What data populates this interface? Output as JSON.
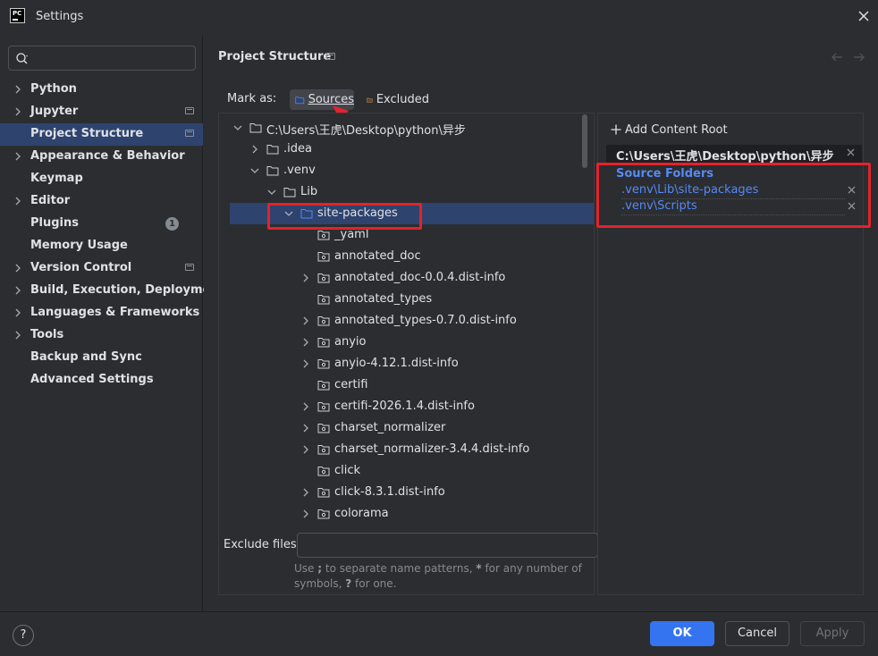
{
  "window": {
    "title": "Settings",
    "logo_text": "PC"
  },
  "search": {
    "value": "",
    "placeholder": ""
  },
  "sidebar": {
    "items": [
      {
        "label": "Python",
        "expandable": true
      },
      {
        "label": "Jupyter",
        "expandable": true,
        "project_icon": true
      },
      {
        "label": "Project Structure",
        "selected": true,
        "project_icon": true
      },
      {
        "label": "Appearance & Behavior",
        "expandable": true
      },
      {
        "label": "Keymap"
      },
      {
        "label": "Editor",
        "expandable": true
      },
      {
        "label": "Plugins",
        "badge": "1"
      },
      {
        "label": "Memory Usage"
      },
      {
        "label": "Version Control",
        "expandable": true,
        "project_icon": true
      },
      {
        "label": "Build, Execution, Deployment",
        "expandable": true
      },
      {
        "label": "Languages & Frameworks",
        "expandable": true
      },
      {
        "label": "Tools",
        "expandable": true
      },
      {
        "label": "Backup and Sync"
      },
      {
        "label": "Advanced Settings"
      }
    ]
  },
  "main": {
    "title": "Project Structure",
    "mark_as": {
      "label": "Mark as:",
      "sources_label": "Sources",
      "excluded_label": "Excluded"
    },
    "tree": {
      "rows": [
        {
          "label": "C:\\Users\\王虎\\Desktop\\python\\异步",
          "depth": 0,
          "chevron": "down",
          "type": "folder"
        },
        {
          "label": ".idea",
          "depth": 1,
          "chevron": "right",
          "type": "folder"
        },
        {
          "label": ".venv",
          "depth": 1,
          "chevron": "down",
          "type": "folder"
        },
        {
          "label": "Lib",
          "depth": 2,
          "chevron": "down",
          "type": "folder"
        },
        {
          "label": "site-packages",
          "depth": 3,
          "chevron": "down",
          "type": "source",
          "selected": true
        },
        {
          "label": "_yaml",
          "depth": 4,
          "chevron": "none",
          "type": "package"
        },
        {
          "label": "annotated_doc",
          "depth": 4,
          "chevron": "none",
          "type": "package"
        },
        {
          "label": "annotated_doc-0.0.4.dist-info",
          "depth": 4,
          "chevron": "right",
          "type": "package"
        },
        {
          "label": "annotated_types",
          "depth": 4,
          "chevron": "none",
          "type": "package"
        },
        {
          "label": "annotated_types-0.7.0.dist-info",
          "depth": 4,
          "chevron": "right",
          "type": "package"
        },
        {
          "label": "anyio",
          "depth": 4,
          "chevron": "right",
          "type": "package"
        },
        {
          "label": "anyio-4.12.1.dist-info",
          "depth": 4,
          "chevron": "right",
          "type": "package"
        },
        {
          "label": "certifi",
          "depth": 4,
          "chevron": "none",
          "type": "package"
        },
        {
          "label": "certifi-2026.1.4.dist-info",
          "depth": 4,
          "chevron": "right",
          "type": "package"
        },
        {
          "label": "charset_normalizer",
          "depth": 4,
          "chevron": "right",
          "type": "package"
        },
        {
          "label": "charset_normalizer-3.4.4.dist-info",
          "depth": 4,
          "chevron": "right",
          "type": "package"
        },
        {
          "label": "click",
          "depth": 4,
          "chevron": "none",
          "type": "package"
        },
        {
          "label": "click-8.3.1.dist-info",
          "depth": 4,
          "chevron": "right",
          "type": "package"
        },
        {
          "label": "colorama",
          "depth": 4,
          "chevron": "right",
          "type": "package"
        }
      ]
    },
    "exclude": {
      "label": "Exclude files:",
      "value": "",
      "hint_parts": [
        "Use ",
        ";",
        " to separate name patterns, ",
        "*",
        " for any number of symbols, ",
        "?",
        " for one."
      ]
    },
    "roots": {
      "add_label": "Add Content Root",
      "root_path": "C:\\Users\\王虎\\Desktop\\python\\异步",
      "source_title": "Source Folders",
      "source_folders": [
        ".venv\\Lib\\site-packages",
        ".venv\\Scripts"
      ]
    }
  },
  "footer": {
    "help": "?",
    "ok": "OK",
    "cancel": "Cancel",
    "apply": "Apply"
  },
  "colors": {
    "accent": "#3574f0",
    "selection": "#2e436e",
    "source_blue": "#548af7",
    "annotation_red": "#e5222b"
  }
}
